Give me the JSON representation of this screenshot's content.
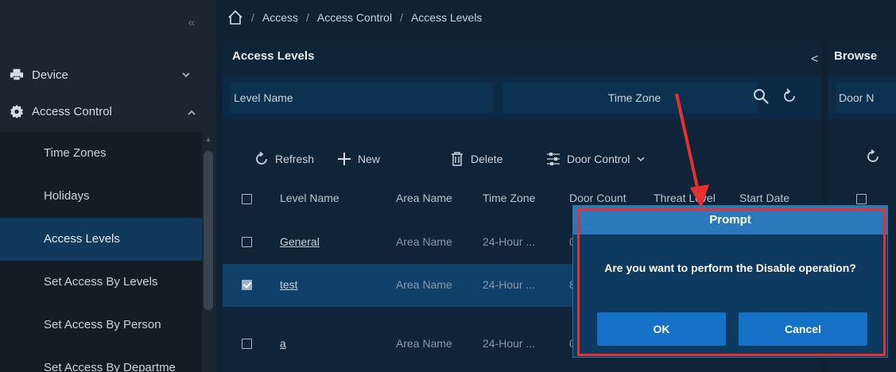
{
  "sidebar": {
    "collapse_glyph": "«",
    "menus": [
      {
        "label": "Device",
        "icon": "printer-icon",
        "expanded": false
      },
      {
        "label": "Access Control",
        "icon": "gear-icon",
        "expanded": true
      }
    ],
    "items": [
      {
        "label": "Time Zones",
        "active": false
      },
      {
        "label": "Holidays",
        "active": false
      },
      {
        "label": "Access Levels",
        "active": true
      },
      {
        "label": "Set Access By Levels",
        "active": false
      },
      {
        "label": "Set Access By Person",
        "active": false
      },
      {
        "label": "Set Access By Departme",
        "active": false
      }
    ]
  },
  "breadcrumb": {
    "separator": "/",
    "items": [
      "Access",
      "Access Control",
      "Access Levels"
    ]
  },
  "main": {
    "title": "Access Levels",
    "collapse_glyph": "<",
    "search": {
      "level_name_label": "Level Name",
      "time_zone_label": "Time Zone"
    },
    "toolbar": {
      "refresh": "Refresh",
      "new": "New",
      "delete": "Delete",
      "door_control": "Door Control"
    },
    "table": {
      "columns": [
        "Level Name",
        "Area Name",
        "Time Zone",
        "Door Count",
        "Threat Level",
        "Start Date"
      ],
      "rows": [
        {
          "level_name": "General",
          "area_name": "Area Name",
          "time_zone": "24-Hour ...",
          "door_count": "0",
          "selected": false
        },
        {
          "level_name": "test",
          "area_name": "Area Name",
          "time_zone": "24-Hour ...",
          "door_count": "8",
          "selected": true
        },
        {
          "level_name": "a",
          "area_name": "Area Name",
          "time_zone": "24-Hour ...",
          "door_count": "0",
          "selected": false
        }
      ]
    }
  },
  "browse": {
    "title": "Browse",
    "field_label": "Door N"
  },
  "modal": {
    "title": "Prompt",
    "message": "Are you want to perform the Disable operation?",
    "ok": "OK",
    "cancel": "Cancel"
  },
  "colors": {
    "accent": "#2b79ba",
    "button": "#1471c6",
    "highlight": "#e5312f",
    "active_item": "#11395c"
  }
}
